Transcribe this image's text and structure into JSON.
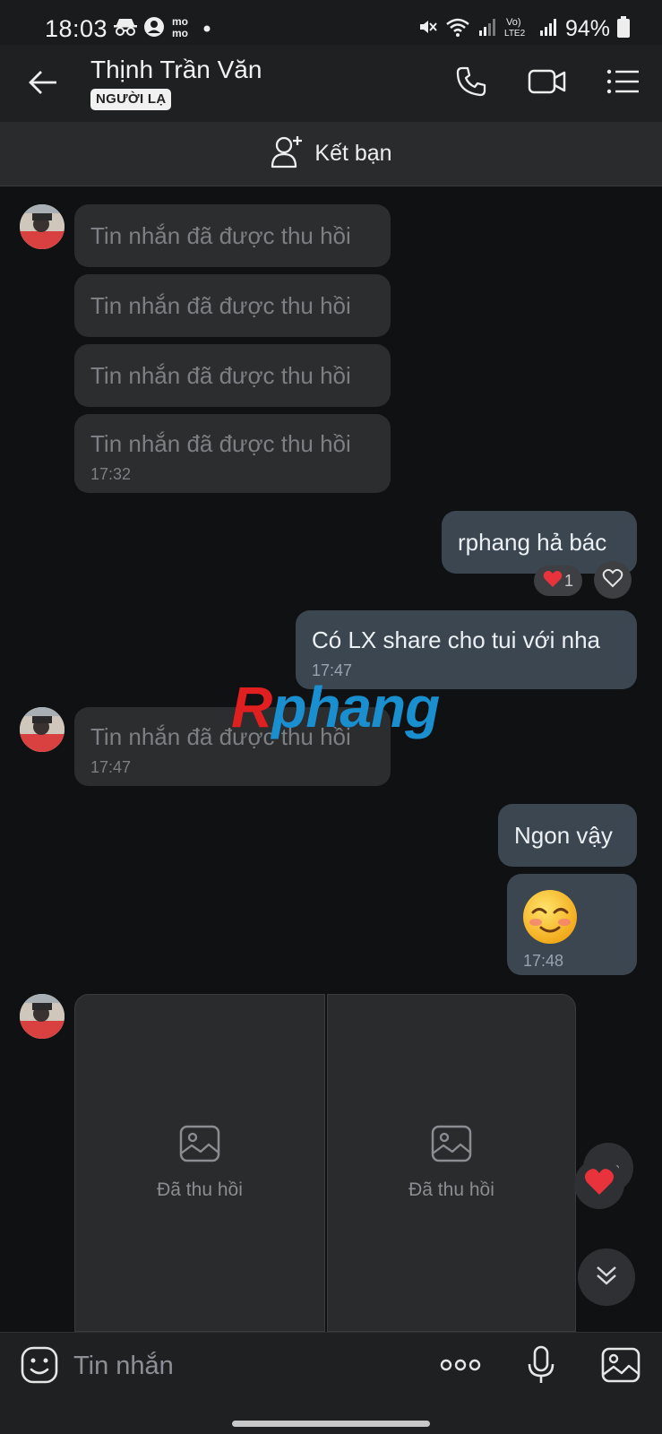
{
  "status_bar": {
    "time": "18:03",
    "left_icons": [
      "incognito-icon",
      "account-circle-icon",
      "momo-icon",
      "dot-icon"
    ],
    "momo_label": "mo\nmo",
    "right_icons": [
      "mute-vibrate-icon",
      "wifi-icon",
      "signal-icon",
      "volte-icon",
      "signal-icon"
    ],
    "volte_label": "Vo) LTE2",
    "battery": "94%"
  },
  "header": {
    "contact_name": "Thịnh Trần Văn",
    "badge": "NGƯỜI LẠ"
  },
  "add_friend": {
    "label": "Kết bạn"
  },
  "messages": {
    "recalled_text": "Tin nhắn đã được thu hồi",
    "group1_time": "17:32",
    "out1_text": "rphang hả bác",
    "out1_reaction_count": "1",
    "out2_text": "Có LX share cho tui với nha",
    "out2_time": "17:47",
    "group2_time": "17:47",
    "out3_text": "Ngon vậy",
    "emoji_time": "17:48",
    "image_recalled_label": "Đã thu hồi"
  },
  "watermark": {
    "part1": "R",
    "part2": "phang"
  },
  "input": {
    "placeholder": "Tin nhắn"
  },
  "colors": {
    "background": "#101112",
    "incoming_bubble": "#2c2d2f",
    "outgoing_bubble": "#3b4651",
    "reaction_heart": "#e8323c"
  }
}
